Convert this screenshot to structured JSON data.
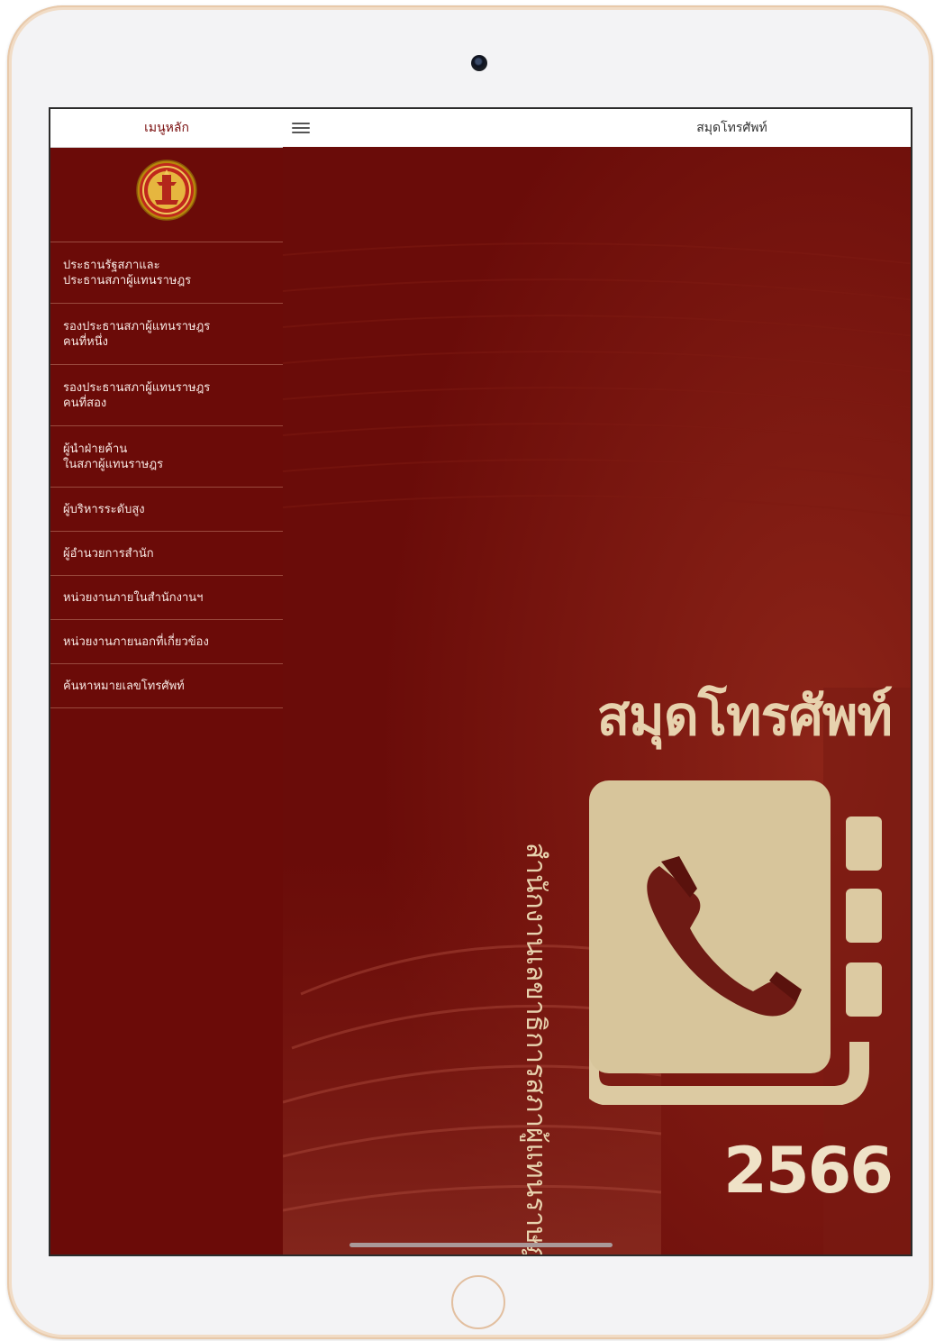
{
  "sidebar": {
    "title": "เมนูหลัก",
    "emblem_icon": "parliament-emblem",
    "items": [
      {
        "lines": [
          "ประธานรัฐสภาและ",
          "ประธานสภาผู้แทนราษฎร"
        ]
      },
      {
        "lines": [
          "รองประธานสภาผู้แทนราษฎร",
          "คนที่หนึ่ง"
        ]
      },
      {
        "lines": [
          "รองประธานสภาผู้แทนราษฎร",
          "คนที่สอง"
        ]
      },
      {
        "lines": [
          "ผู้นำฝ่ายค้าน",
          "ในสภาผู้แทนราษฎร"
        ]
      },
      {
        "lines": [
          "ผู้บริหารระดับสูง"
        ]
      },
      {
        "lines": [
          "ผู้อำนวยการสำนัก"
        ]
      },
      {
        "lines": [
          "หน่วยงานภายในสำนักงานฯ"
        ]
      },
      {
        "lines": [
          "หน่วยงานภายนอกที่เกี่ยวข้อง"
        ]
      },
      {
        "lines": [
          "ค้นหาหมายเลขโทรศัพท์"
        ]
      }
    ]
  },
  "header": {
    "title": "สมุดโทรศัพท์",
    "menu_icon": "hamburger-icon"
  },
  "cover": {
    "title": "สมุดโทรศัพท์",
    "organization": "สำนักงานเลขาธิการสภาผู้แทนราษฎร",
    "year": "2566",
    "icon": "phone-book-icon"
  },
  "colors": {
    "sidebar_bg": "#6b0b08",
    "cover_bg": "#6e0d0a",
    "accent_gold": "#e7d2ae",
    "device_frame": "#e8c9aa"
  }
}
